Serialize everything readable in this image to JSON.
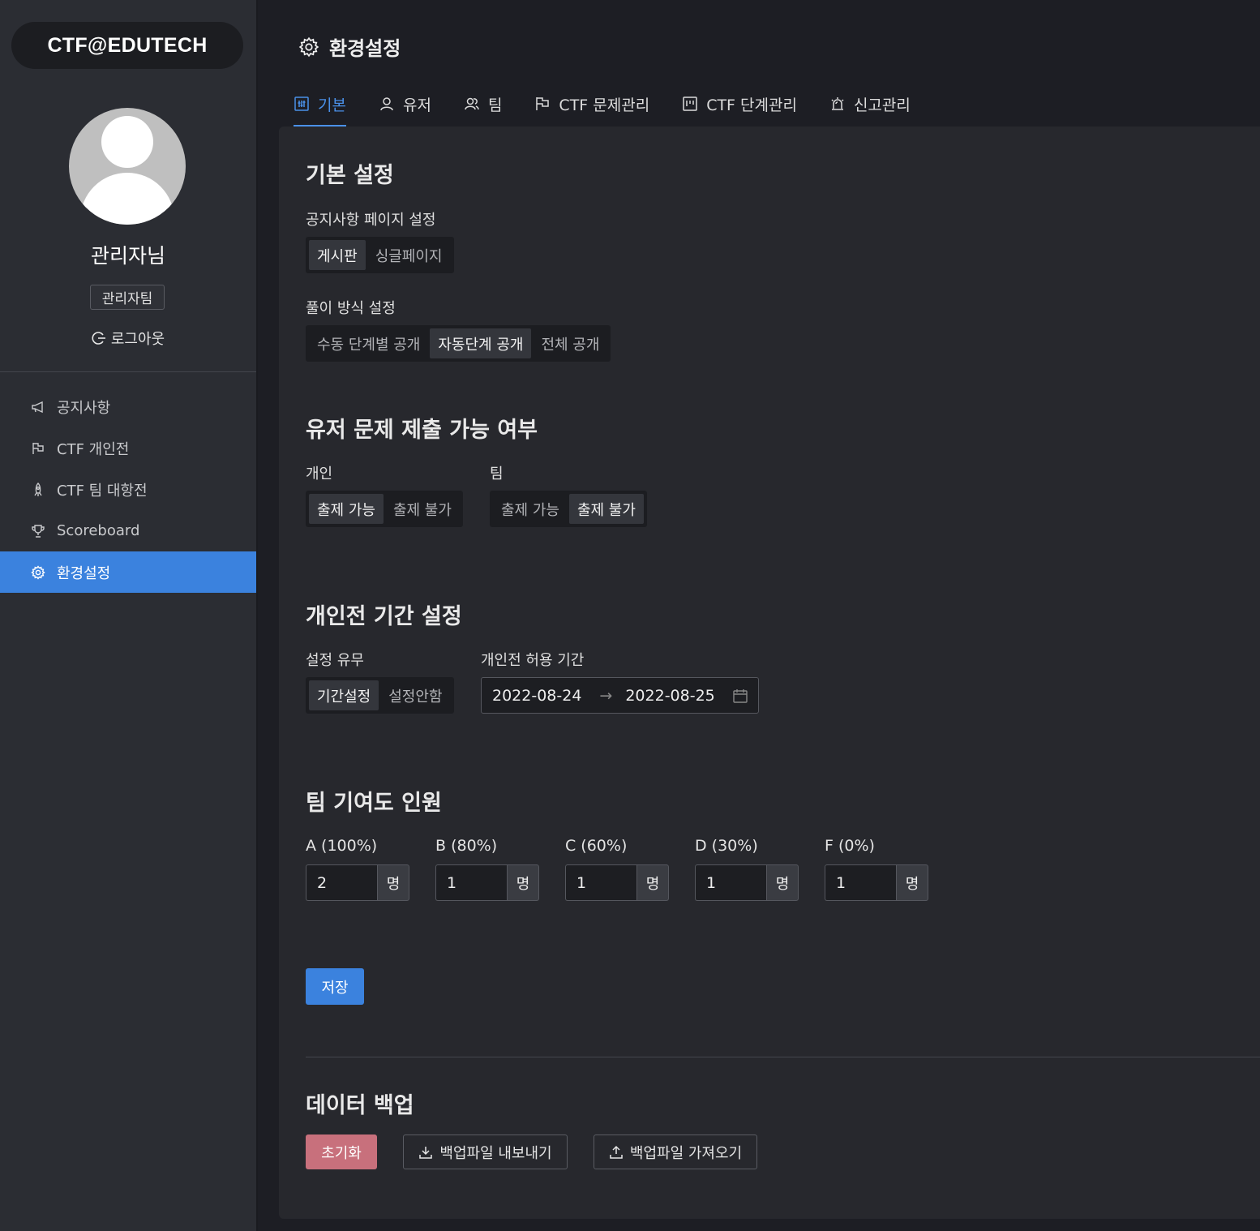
{
  "sidebar": {
    "brand": "CTF@EDUTECH",
    "username": "관리자님",
    "team": "관리자팀",
    "logout": "로그아웃",
    "items": [
      {
        "label": "공지사항",
        "icon": "megaphone-icon"
      },
      {
        "label": "CTF 개인전",
        "icon": "flag-icon"
      },
      {
        "label": "CTF 팀 대항전",
        "icon": "rocket-icon"
      },
      {
        "label": "Scoreboard",
        "icon": "trophy-icon"
      },
      {
        "label": "환경설정",
        "icon": "gear-icon"
      }
    ]
  },
  "header": {
    "title": "환경설정",
    "tabs": [
      {
        "label": "기본",
        "icon": "sliders-icon"
      },
      {
        "label": "유저",
        "icon": "user-icon"
      },
      {
        "label": "팀",
        "icon": "team-icon"
      },
      {
        "label": "CTF 문제관리",
        "icon": "flag-icon"
      },
      {
        "label": "CTF 단계관리",
        "icon": "project-icon"
      },
      {
        "label": "신고관리",
        "icon": "alert-icon"
      }
    ]
  },
  "basic": {
    "title": "기본 설정",
    "notice_label": "공지사항 페이지 설정",
    "notice_options": [
      "게시판",
      "싱글페이지"
    ],
    "solve_label": "풀이 방식 설정",
    "solve_options": [
      "수동 단계별 공개",
      "자동단계 공개",
      "전체 공개"
    ]
  },
  "submit": {
    "title": "유저 문제 제출 가능 여부",
    "personal_label": "개인",
    "personal_options": [
      "출제 가능",
      "출제 불가"
    ],
    "team_label": "팀",
    "team_options": [
      "출제 가능",
      "출제 불가"
    ]
  },
  "period": {
    "title": "개인전 기간 설정",
    "toggle_label": "설정 유무",
    "toggle_options": [
      "기간설정",
      "설정안함"
    ],
    "range_label": "개인전 허용 기간",
    "start": "2022-08-24",
    "arrow": "→",
    "end": "2022-08-25"
  },
  "contribution": {
    "title": "팀 기여도 인원",
    "unit": "명",
    "grades": [
      {
        "label": "A (100%)",
        "value": "2"
      },
      {
        "label": "B (80%)",
        "value": "1"
      },
      {
        "label": "C (60%)",
        "value": "1"
      },
      {
        "label": "D (30%)",
        "value": "1"
      },
      {
        "label": "F (0%)",
        "value": "1"
      }
    ]
  },
  "save_label": "저장",
  "backup": {
    "title": "데이터 백업",
    "reset": "초기화",
    "export": "백업파일 내보내기",
    "import": "백업파일 가져오기"
  },
  "colors": {
    "accent": "#3b82de",
    "danger": "#c8707c"
  }
}
